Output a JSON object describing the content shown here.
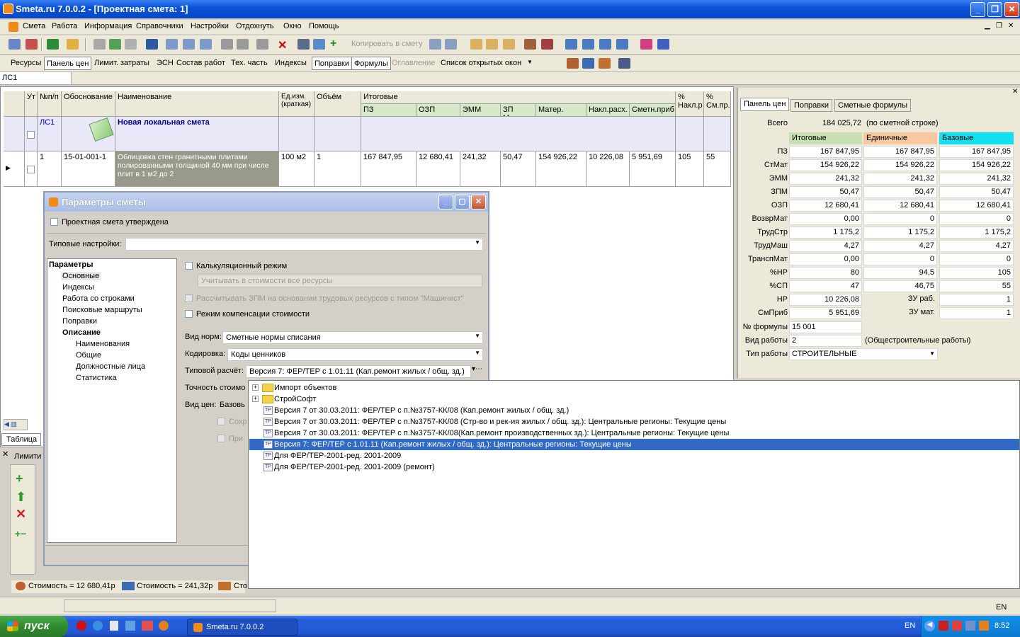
{
  "window": {
    "title": "Smeta.ru  7.0.0.2   - [Проектная смета: 1]"
  },
  "menu": [
    "Смета",
    "Работа",
    "Информация",
    "Справочники",
    "Настройки",
    "Отдохнуть",
    "Окно",
    "Помощь"
  ],
  "toolbar": {
    "copy_label": "Копировать в смету"
  },
  "tabs": [
    "Ресурсы",
    "Панель цен",
    "Лимит. затраты",
    "ЭСН",
    "Состав работ",
    "Тех. часть",
    "Индексы",
    "Поправки",
    "Формулы",
    "Оглавление",
    "Список открытых окон"
  ],
  "address": "ЛС1",
  "grid": {
    "headers": {
      "ut": "Ут",
      "num": "№п/п",
      "basis": "Обоснование",
      "name": "Наименование",
      "unit": "Ед.изм. (краткая)",
      "volume": "Объём",
      "totals": "Итоговые",
      "pz": "ПЗ",
      "ozp": "ОЗП",
      "emm": "ЭММ",
      "zpmash": "ЗП Маш.",
      "mater": "Матер.",
      "nakl": "Накл.расх.",
      "smetpr": "Сметн.приб",
      "pct_nakl": "% Накл.р",
      "pct_sm": "% См.пр."
    },
    "row1": {
      "num": "ЛС1",
      "name": "Новая локальная смета"
    },
    "row2": {
      "num": "1",
      "basis": "15-01-001-1",
      "name": "Облицовка стен гранитными плитами полированными толщиной 40 мм при числе плит в 1 м2 до 2",
      "unit": "100 м2",
      "volume": "1",
      "pz": "167 847,95",
      "ozp": "12 680,41",
      "emm": "241,32",
      "zpmash": "50,47",
      "mater": "154 926,22",
      "nakl": "10 226,08",
      "smetpr": "5 951,69",
      "pct_nakl": "105",
      "pct_sm": "55"
    }
  },
  "bottom_tabs": {
    "table": "Таблица",
    "limits": "Лимити"
  },
  "status": {
    "s1": "Стоимость = 12 680,41р",
    "s2": "Стоимость = 241,32р",
    "s3": "Сто",
    "lang": "EN"
  },
  "right_panel": {
    "tabs": [
      "Панель цен",
      "Поправки",
      "Сметные формулы"
    ],
    "total_label": "Всего",
    "total_value": "184 025,72",
    "total_note": "(по сметной строке)",
    "col_headers": [
      "Итоговые",
      "Единичные",
      "Базовые"
    ],
    "rows": [
      {
        "label": "ПЗ",
        "v1": "167 847,95",
        "v2": "167 847,95",
        "v3": "167 847,95"
      },
      {
        "label": "СтМат",
        "v1": "154 926,22",
        "v2": "154 926,22",
        "v3": "154 926,22"
      },
      {
        "label": "ЭММ",
        "v1": "241,32",
        "v2": "241,32",
        "v3": "241,32"
      },
      {
        "label": "ЗПМ",
        "v1": "50,47",
        "v2": "50,47",
        "v3": "50,47"
      },
      {
        "label": "ОЗП",
        "v1": "12 680,41",
        "v2": "12 680,41",
        "v3": "12 680,41"
      },
      {
        "label": "ВозврМат",
        "v1": "0,00",
        "v2": "0",
        "v3": "0"
      },
      {
        "label": "ТрудСтр",
        "v1": "1 175,2",
        "v2": "1 175,2",
        "v3": "1 175,2"
      },
      {
        "label": "ТрудМаш",
        "v1": "4,27",
        "v2": "4,27",
        "v3": "4,27"
      },
      {
        "label": "ТранспМат",
        "v1": "0,00",
        "v2": "0",
        "v3": "0"
      },
      {
        "label": "%НР",
        "v1": "80",
        "v2": "94,5",
        "v3": "105"
      },
      {
        "label": "%СП",
        "v1": "47",
        "v2": "46,75",
        "v3": "55"
      },
      {
        "label": "НР",
        "v1": "10 226,08",
        "v2": "ЗУ раб.",
        "v3": "1"
      },
      {
        "label": "СмПриб",
        "v1": "5 951,69",
        "v2": "ЗУ мат.",
        "v3": "1"
      }
    ],
    "formula_label": "№ формулы",
    "formula_value": "15 001",
    "work_label": "Вид работы",
    "work_value": "2",
    "work_note": "(Общестроительные работы)",
    "type_label": "Тип работы",
    "type_value": "СТРОИТЕЛЬНЫЕ"
  },
  "dialog": {
    "title": "Параметры сметы",
    "approved": "Проектная смета утверждена",
    "typical_label": "Типовые настройки:",
    "tree": [
      "Параметры",
      "Основные",
      "Индексы",
      "Работа со строками",
      "Поисковые маршруты",
      "Поправки",
      "Описание",
      "Наименования",
      "Общие",
      "Должностные лица",
      "Статистика"
    ],
    "calc_mode": "Калькуляционный режим",
    "include_cost": "Учитывать в стоимости все ресурсы",
    "zpm_calc": "Рассчитывать ЗПМ на основании трудовых ресурсов с типом \"Машинист\"",
    "compensation": "Режим компенсации стоимости",
    "norm_label": "Вид норм:",
    "norm_value": "Сметные нормы списания",
    "code_label": "Кодировка:",
    "code_value": "Коды ценников",
    "typcalc_label": "Типовой расчёт:",
    "typcalc_value": "Версия 7: ФЕР/ТЕР с 1.01.11 (Кап.ремонт жилых / общ. зд.)",
    "accuracy_label": "Точность стоимо",
    "price_label": "Вид цен:",
    "price_value": "Базовь",
    "save_label": "Сохр",
    "apply_label": "При"
  },
  "dropdown": [
    {
      "text": "Импорт объектов",
      "kind": "folder"
    },
    {
      "text": "СтройСофт",
      "kind": "folder"
    },
    {
      "text": "Версия 7 от 30.03.2011: ФЕР/ТЕР с п.№3757-КК/08 (Кап.ремонт жилых / общ. зд.)",
      "kind": "item"
    },
    {
      "text": "Версия 7 от 30.03.2011: ФЕР/ТЕР с п.№3757-КК/08 (Стр-во и рек-ия жилых / общ. зд.): Центральные регионы: Текущие цены",
      "kind": "item"
    },
    {
      "text": "Версия 7 от 30.03.2011: ФЕР/ТЕР с п.№3757-КК/08(Кап.ремонт производственных зд.): Центральные регионы: Текущие цены",
      "kind": "item"
    },
    {
      "text": "Версия 7: ФЕР/ТЕР с 1.01.11 (Кап.ремонт жилых / общ. зд.): Центральные регионы: Текущие цены",
      "kind": "item"
    },
    {
      "text": "Для ФЕР/ТЕР-2001-ред. 2001-2009",
      "kind": "item"
    },
    {
      "text": "Для ФЕР/ТЕР-2001-ред. 2001-2009 (ремонт)",
      "kind": "item"
    }
  ],
  "taskbar": {
    "start": "пуск",
    "task": "Smeta.ru  7.0.0.2",
    "lang": "EN",
    "time": "8:52"
  }
}
